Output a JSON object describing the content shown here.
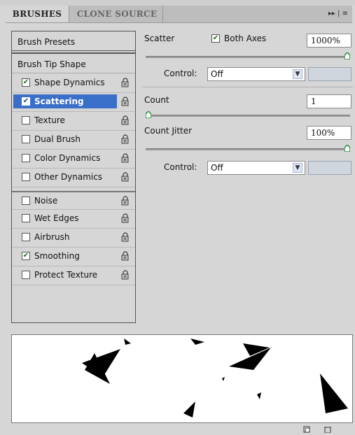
{
  "tabs": {
    "active": "BRUSHES",
    "inactive": "CLONE SOURCE",
    "menu": "▸▸ | ≡"
  },
  "left": {
    "presets": "Brush Presets",
    "tip_shape": "Brush Tip Shape",
    "items": [
      {
        "label": "Shape Dynamics",
        "checked": true,
        "selected": false
      },
      {
        "label": "Scattering",
        "checked": true,
        "selected": true
      },
      {
        "label": "Texture",
        "checked": false,
        "selected": false
      },
      {
        "label": "Dual Brush",
        "checked": false,
        "selected": false
      },
      {
        "label": "Color Dynamics",
        "checked": false,
        "selected": false
      },
      {
        "label": "Other Dynamics",
        "checked": false,
        "selected": false
      },
      {
        "label": "Noise",
        "checked": false,
        "selected": false
      },
      {
        "label": "Wet Edges",
        "checked": false,
        "selected": false
      },
      {
        "label": "Airbrush",
        "checked": false,
        "selected": false
      },
      {
        "label": "Smoothing",
        "checked": true,
        "selected": false
      },
      {
        "label": "Protect Texture",
        "checked": false,
        "selected": false
      }
    ]
  },
  "right": {
    "scatter_label": "Scatter",
    "both_axes_label": "Both Axes",
    "both_axes_checked": true,
    "scatter_value": "1000%",
    "scatter_level": 1.0,
    "control1_label": "Control:",
    "control1_value": "Off",
    "count_label": "Count",
    "count_value": "1",
    "count_level": 0.0,
    "count_jitter_label": "Count Jitter",
    "count_jitter_value": "100%",
    "count_jitter_level": 1.0,
    "control2_label": "Control:",
    "control2_value": "Off"
  },
  "icons": {
    "lock": "lock-icon",
    "thumb": "slider-thumb-icon",
    "new": "new-preset-icon",
    "trash": "trash-icon"
  },
  "colors": {
    "selection": "#3a6fc9",
    "panel": "#d6d6d6",
    "check": "#1f6b1f"
  }
}
